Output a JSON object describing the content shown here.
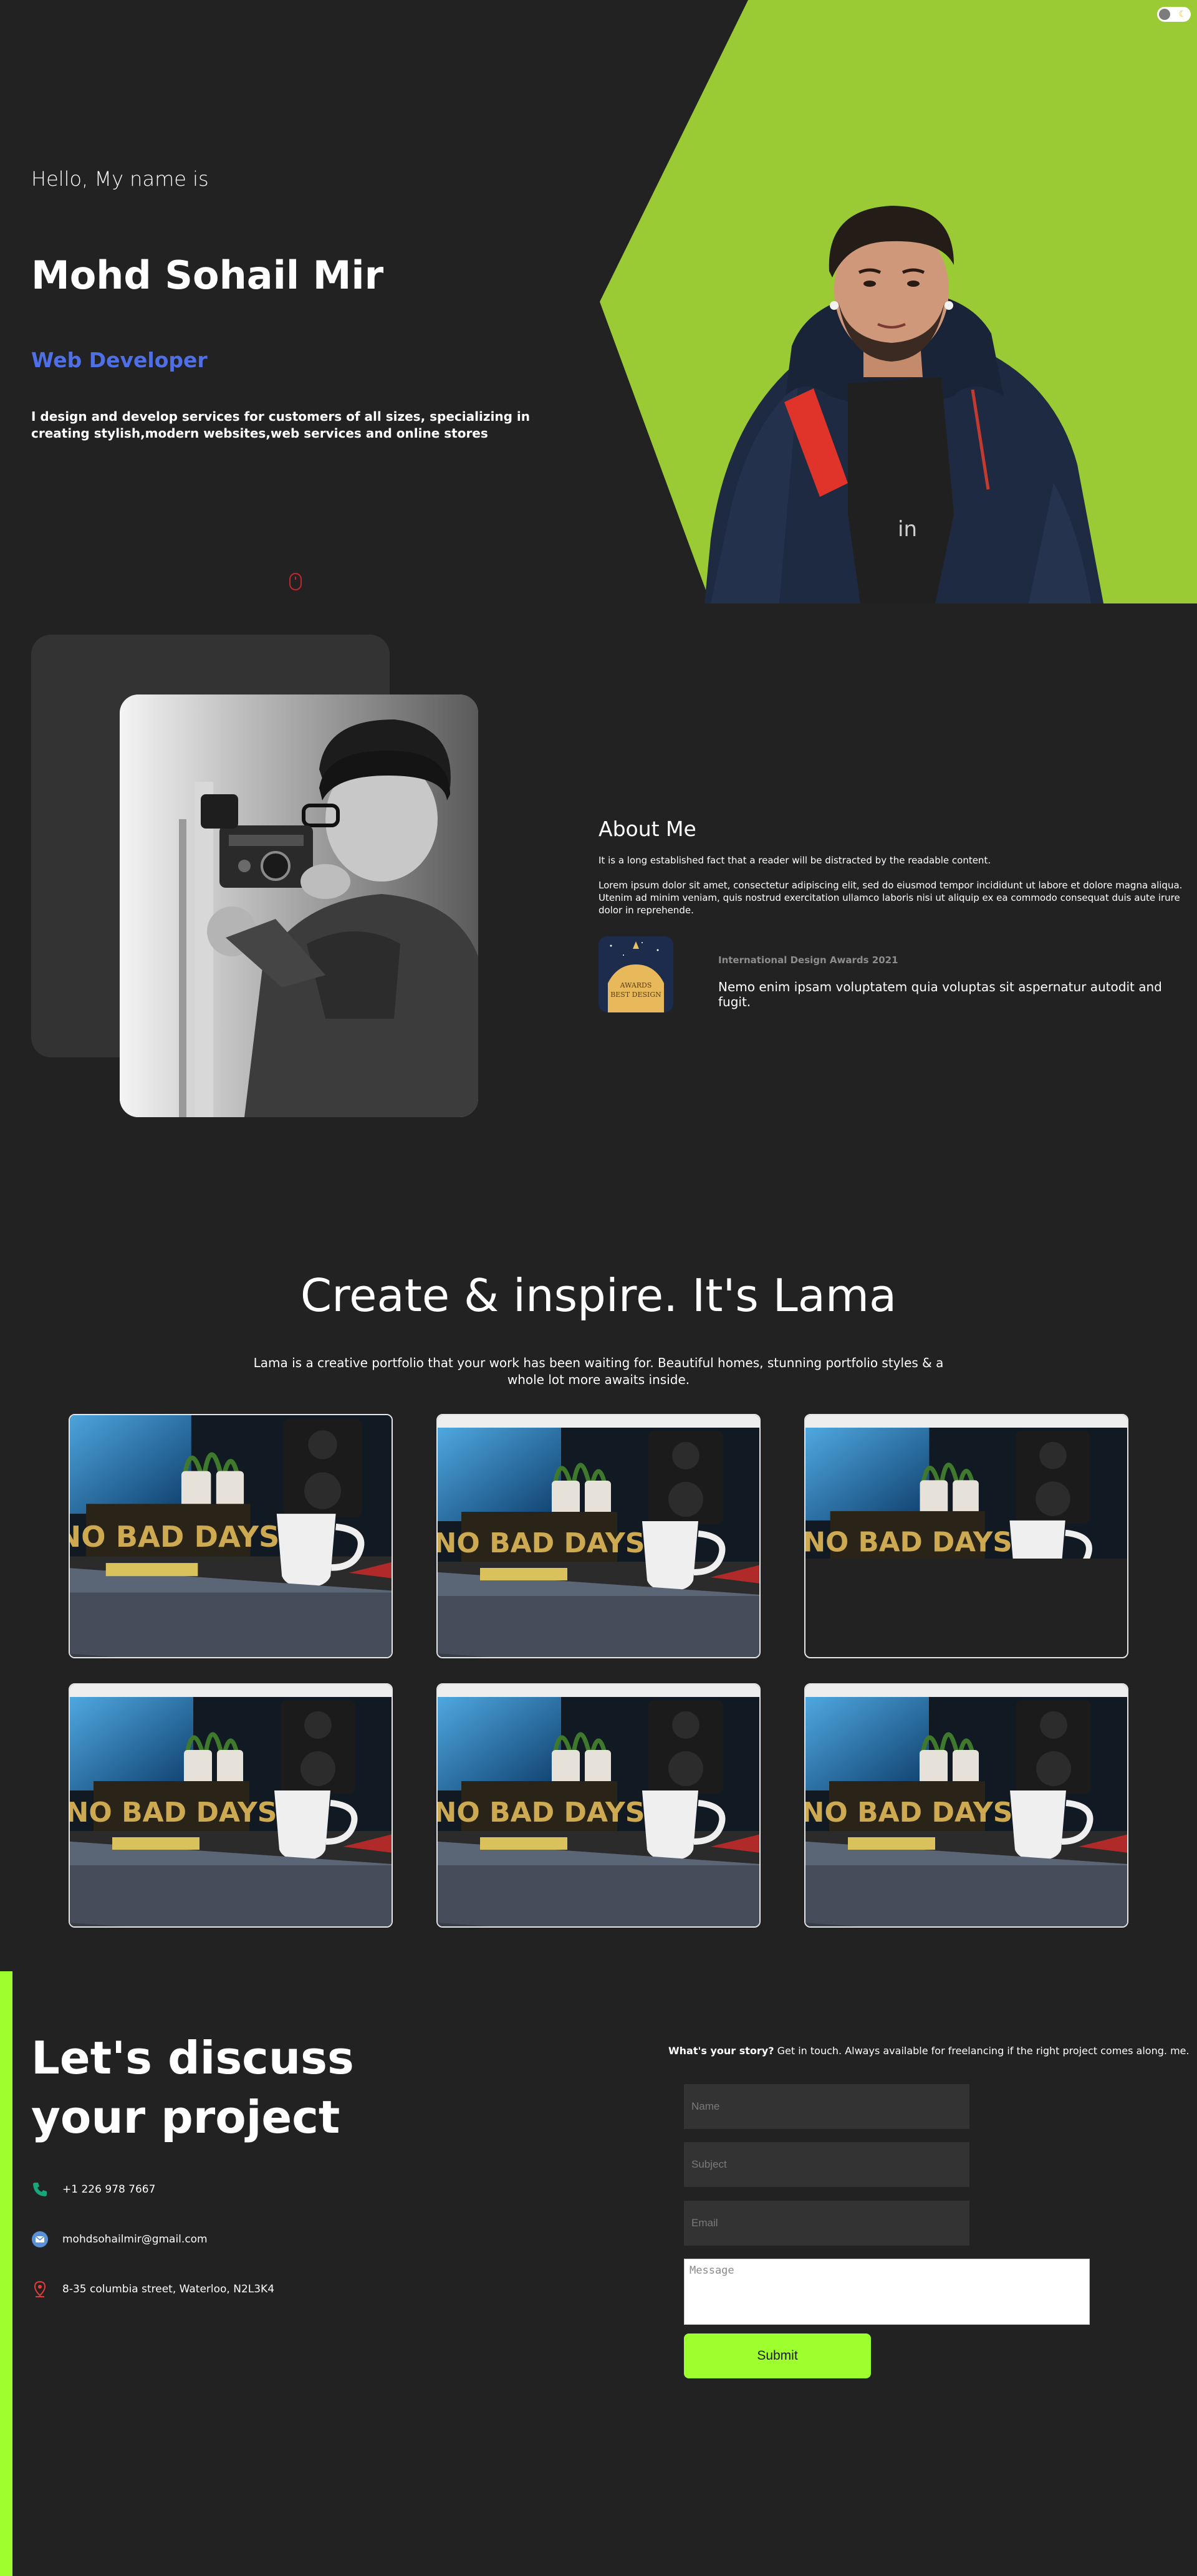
{
  "colors": {
    "background": "#222222",
    "accent_green": "#9acb34",
    "accent_lime": "#9eff2f",
    "role_blue": "#4f6fe6",
    "muted_gray": "#8d8d8d"
  },
  "theme_toggle": {
    "icon": "moon-icon",
    "glyph": "☾"
  },
  "hero": {
    "greeting": "Hello, My name is",
    "name": "Mohd Sohail Mir",
    "role": "Web Developer",
    "description": "I design and develop services for customers of all sizes, specializing in creating stylish,modern websites,web services and online stores",
    "scroll_icon": "mouse-icon"
  },
  "about": {
    "title": "About Me",
    "lead": "It is a long established fact that a reader will be distracted by the readable content.",
    "body": "Lorem ipsum dolor sit amet, consectetur adipiscing elit, sed do eiusmod tempor incididunt ut labore et dolore magna aliqua. Utenim ad minim veniam, quis nostrud exercitation ullamco laboris nisi ut aliquip ex ea commodo consequat duis aute irure dolor in reprehende.",
    "award": {
      "badge_line1": "AWARDS",
      "badge_line2": "BEST DESIGN",
      "label": "International Design Awards 2021",
      "text": "Nemo enim ipsam voluptatem quia voluptas sit aspernatur autodit and fugit."
    }
  },
  "portfolio": {
    "title": "Create & inspire. It's Lama",
    "description": "Lama is a creative portfolio that your work has been waiting for. Beautiful homes, stunning portfolio styles & a whole lot more awaits inside.",
    "item_caption": "NO BAD DAYS"
  },
  "contact": {
    "title": "Let's discuss your project",
    "phone": "+1 226 978 7667",
    "email": "mohdsohailmir@gmail.com",
    "address": "8-35 columbia street, Waterloo, N2L3K4",
    "story_bold": "What's your story?",
    "story_rest": " Get in touch. Always available for freelancing if the right project comes along. me.",
    "placeholders": {
      "name": "Name",
      "subject": "Subject",
      "email": "Email",
      "message": "Message"
    },
    "submit_label": "Submit"
  }
}
